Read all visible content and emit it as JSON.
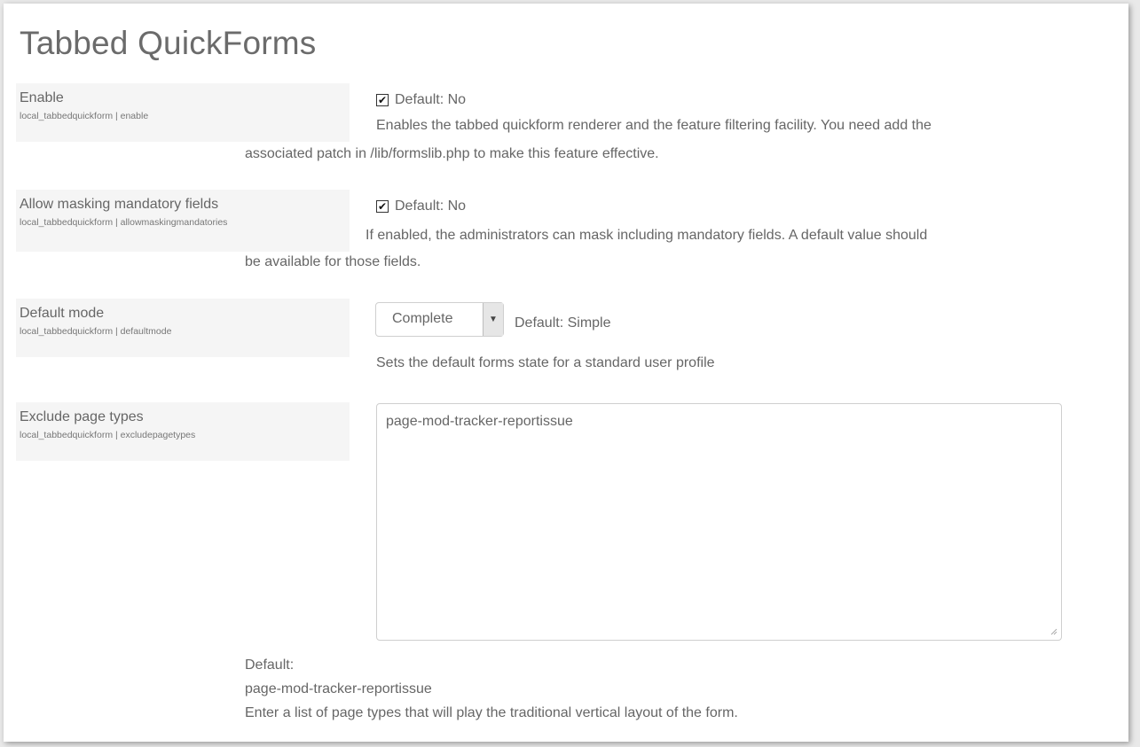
{
  "page_title": "Tabbed QuickForms",
  "settings": {
    "enable": {
      "name": "Enable",
      "key": "local_tabbedquickform | enable",
      "checked": true,
      "default": "Default: No",
      "desc_line1": "Enables the tabbed quickform renderer and the feature filtering facility. You need add the",
      "desc_line2": "associated patch in /lib/formslib.php to make this feature effective."
    },
    "allowmasking": {
      "name": "Allow masking mandatory fields",
      "key": "local_tabbedquickform | allowmaskingmandatories",
      "checked": true,
      "default": "Default: No",
      "desc_line1": "If enabled, the administrators can mask including mandatory fields. A default value should",
      "desc_line2": "be available for those fields."
    },
    "defaultmode": {
      "name": "Default mode",
      "key": "local_tabbedquickform | defaultmode",
      "selected": "Complete",
      "default": "Default: Simple",
      "desc": "Sets the default forms state for a standard user profile"
    },
    "excludepagetypes": {
      "name": "Exclude page types",
      "key": "local_tabbedquickform | excludepagetypes",
      "value": "page-mod-tracker-reportissue",
      "default_label": "Default:",
      "default_value": "page-mod-tracker-reportissue",
      "desc": "Enter a list of page types that will play the traditional vertical layout of the form."
    }
  }
}
